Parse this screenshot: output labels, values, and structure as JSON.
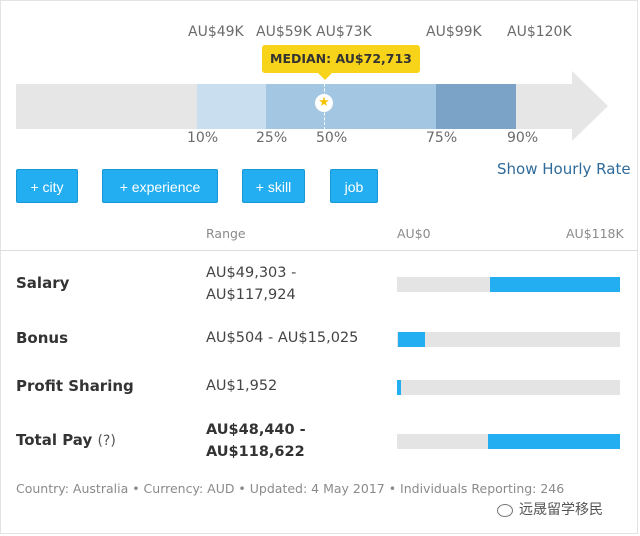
{
  "scale": {
    "top_values": [
      "AU$49K",
      "AU$59K",
      "AU$73K",
      "AU$99K",
      "AU$120K"
    ],
    "percentiles": [
      "10%",
      "25%",
      "50%",
      "75%",
      "90%"
    ],
    "median_label": "MEDIAN: AU$72,713",
    "colors": {
      "track": "#e6e6e6",
      "p10_25": "#c9deee",
      "p25_75": "#a3c6e3",
      "p75_90": "#7aa3c7",
      "badge": "#f7d31a"
    }
  },
  "show_hourly_rate": "Show Hourly Rate",
  "filters": [
    "+ city",
    "+ experience",
    "+ skill",
    "job"
  ],
  "table": {
    "header": {
      "range": "Range",
      "min": "AU$0",
      "max": "AU$118K"
    },
    "rows": [
      {
        "label": "Salary",
        "suffix": "",
        "range_line1": "AU$49,303 -",
        "range_line2": "AU$117,924",
        "bar_start": 0.418,
        "bar_end": 1.0
      },
      {
        "label": "Bonus",
        "suffix": "",
        "range_line1": "AU$504 - AU$15,025",
        "range_line2": "",
        "bar_start": 0.004,
        "bar_end": 0.127
      },
      {
        "label": "Profit Sharing",
        "suffix": "",
        "range_line1": "AU$1,952",
        "range_line2": "",
        "bar_start": 0.0,
        "bar_end": 0.017
      },
      {
        "label": "Total Pay",
        "suffix": "(?)",
        "range_line1": "AU$48,440 -",
        "range_line2": "AU$118,622",
        "bar_start": 0.41,
        "bar_end": 1.0
      }
    ],
    "bar_color": "#22aef0"
  },
  "footer": "Country: Australia • Currency: AUD • Updated: 4 May 2017 • Individuals Reporting: 246",
  "watermark": "远晟留学移民"
}
